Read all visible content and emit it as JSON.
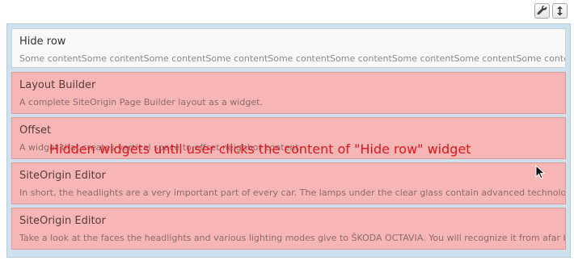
{
  "toolbar": {
    "icons": [
      "wrench-icon",
      "resize-icon"
    ]
  },
  "widgets": [
    {
      "title": "Hide row",
      "description": "Some contentSome contentSome contentSome contentSome contentSome contentSome contentSome contentSome contentSome contentSome"
    }
  ],
  "hidden_widgets": [
    {
      "title": "Layout Builder",
      "description": "A complete SiteOrigin Page Builder layout as a widget."
    },
    {
      "title": "Offset",
      "description": "A widget that creates vertical space to offset neighbor content."
    },
    {
      "title": "SiteOrigin Editor",
      "description": "In short, the headlights are a very important part of every car. The lamps under the clear glass contain advanced technology to ensure"
    },
    {
      "title": "SiteOrigin Editor",
      "description": "Take a look at the faces the headlights and various lighting modes give to ŠKODA OCTAVIA. You will recognize it from afar by the"
    }
  ],
  "annotation": "Hidden widgets until user clicks the content of \"Hide row\" widget",
  "colors": {
    "hidden_bg": "#f6b6b6",
    "frame_bg": "#cfe1ec",
    "annotation": "#e0161b"
  }
}
